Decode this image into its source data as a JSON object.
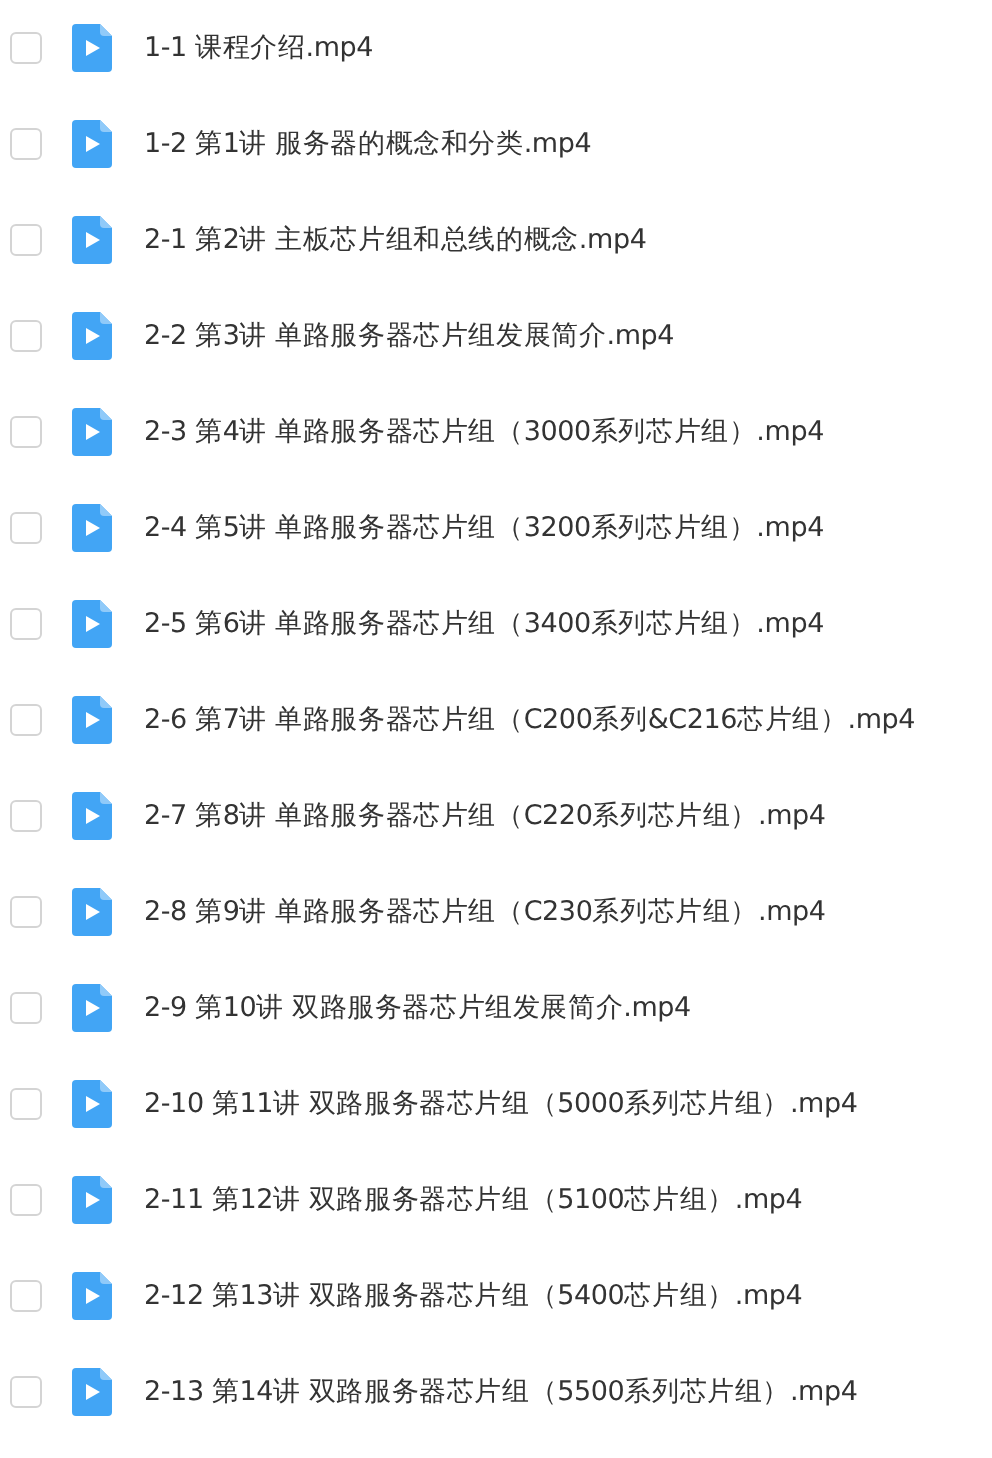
{
  "files": [
    {
      "name": "1-1 课程介绍.mp4",
      "checked": false
    },
    {
      "name": "1-2 第1讲 服务器的概念和分类.mp4",
      "checked": false
    },
    {
      "name": "2-1 第2讲 主板芯片组和总线的概念.mp4",
      "checked": false
    },
    {
      "name": "2-2 第3讲 单路服务器芯片组发展简介.mp4",
      "checked": false
    },
    {
      "name": "2-3 第4讲 单路服务器芯片组（3000系列芯片组）.mp4",
      "checked": false
    },
    {
      "name": "2-4 第5讲 单路服务器芯片组（3200系列芯片组）.mp4",
      "checked": false
    },
    {
      "name": "2-5 第6讲 单路服务器芯片组（3400系列芯片组）.mp4",
      "checked": false
    },
    {
      "name": "2-6 第7讲 单路服务器芯片组（C200系列&C216芯片组）.mp4",
      "checked": false
    },
    {
      "name": "2-7 第8讲 单路服务器芯片组（C220系列芯片组）.mp4",
      "checked": false
    },
    {
      "name": "2-8 第9讲 单路服务器芯片组（C230系列芯片组）.mp4",
      "checked": false
    },
    {
      "name": "2-9 第10讲 双路服务器芯片组发展简介.mp4",
      "checked": false
    },
    {
      "name": "2-10 第11讲 双路服务器芯片组（5000系列芯片组）.mp4",
      "checked": false
    },
    {
      "name": "2-11 第12讲 双路服务器芯片组（5100芯片组）.mp4",
      "checked": false
    },
    {
      "name": "2-12 第13讲 双路服务器芯片组（5400芯片组）.mp4",
      "checked": false
    },
    {
      "name": "2-13 第14讲 双路服务器芯片组（5500系列芯片组）.mp4",
      "checked": false
    }
  ]
}
